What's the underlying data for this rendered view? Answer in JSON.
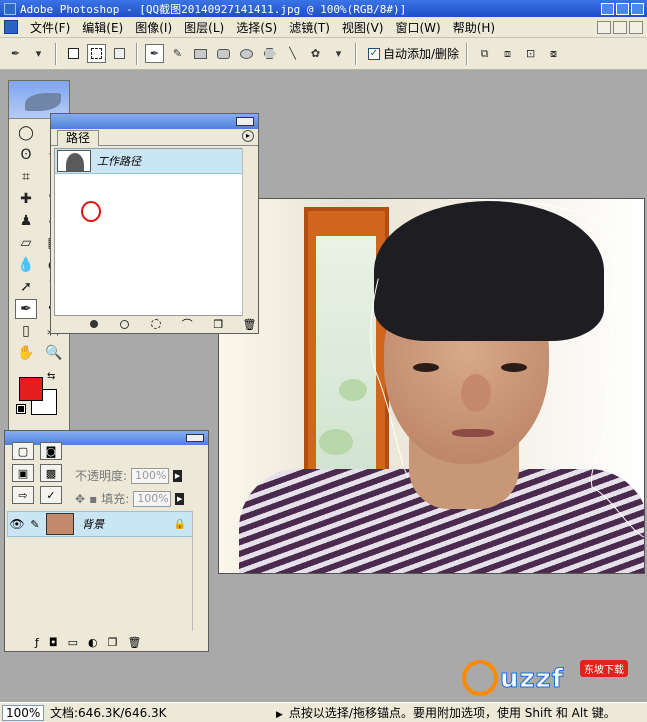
{
  "window": {
    "title": "Adobe Photoshop - [QQ截图20140927141411.jpg @ 100%(RGB/8#)]"
  },
  "menu": [
    "文件(F)",
    "编辑(E)",
    "图像(I)",
    "图层(L)",
    "选择(S)",
    "滤镜(T)",
    "视图(V)",
    "窗口(W)",
    "帮助(H)"
  ],
  "options": {
    "auto_add_label": "自动添加/删除",
    "auto_add_checked": true
  },
  "paths_panel": {
    "tab": "路径",
    "items": [
      {
        "name": "工作路径"
      }
    ]
  },
  "layers_panel": {
    "opacity_label": "不透明度:",
    "opacity_value": "100%",
    "fill_label": "填充:",
    "fill_value": "100%",
    "layers": [
      {
        "name": "背景",
        "locked": true,
        "visible": true
      }
    ]
  },
  "colors": {
    "foreground": "#e41e1e",
    "background": "#ffffff",
    "highlight_circle": "#e01313"
  },
  "status": {
    "zoom": "100%",
    "doc": "文档:646.3K/646.3K",
    "hint": "点按以选择/拖移锚点。要用附加选项，使用 Shift 和 Alt 键。"
  },
  "watermark": {
    "text": "uzzf",
    "badge": "东坡下载"
  }
}
